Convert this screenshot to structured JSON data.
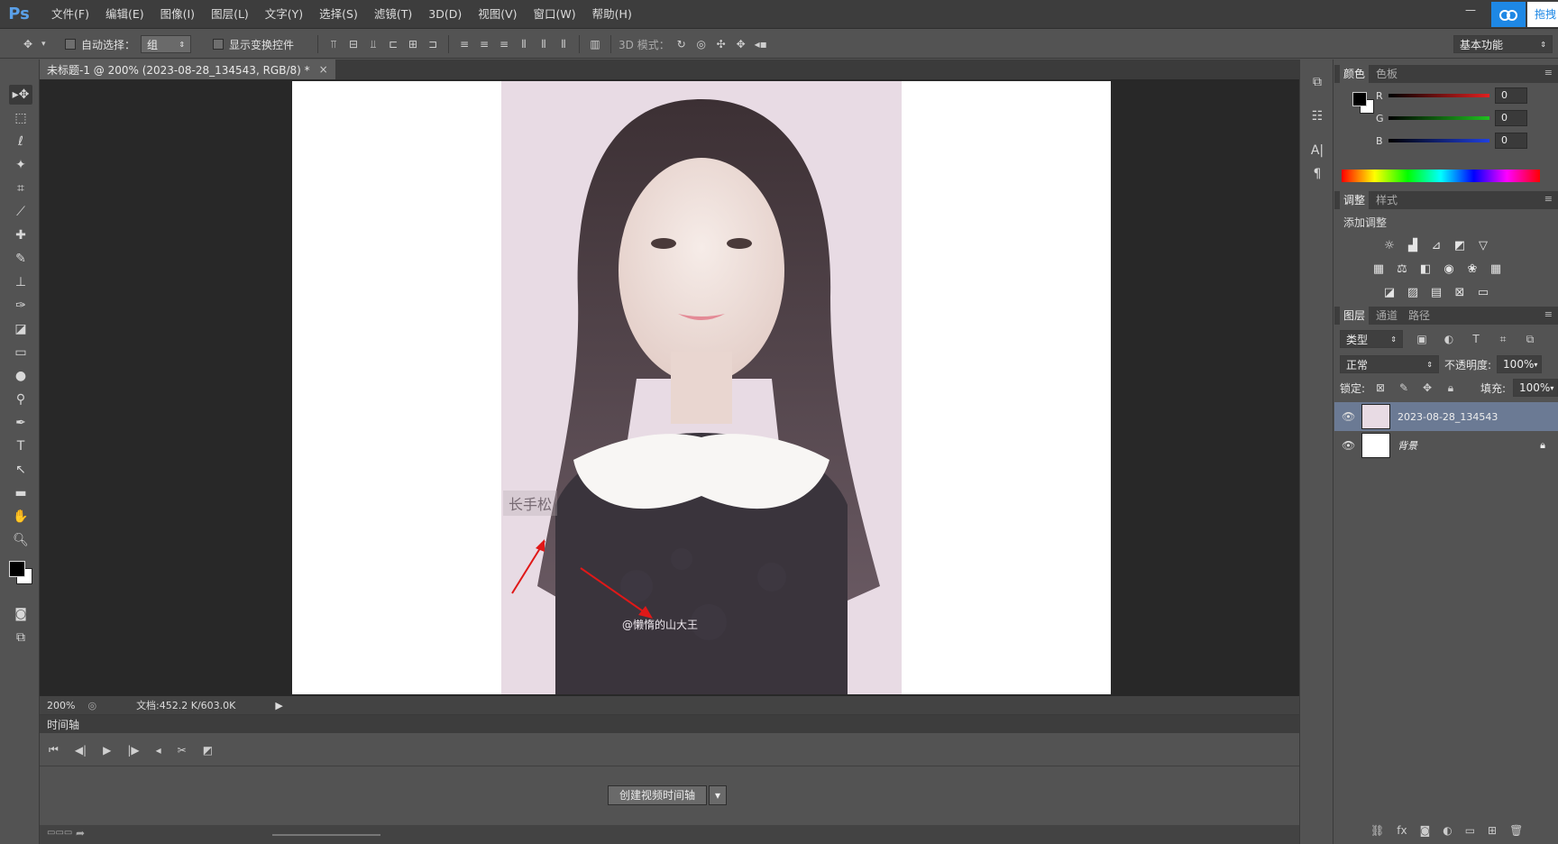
{
  "app": {
    "logo": "Ps"
  },
  "menu": [
    "文件(F)",
    "编辑(E)",
    "图像(I)",
    "图层(L)",
    "文字(Y)",
    "选择(S)",
    "滤镜(T)",
    "3D(D)",
    "视图(V)",
    "窗口(W)",
    "帮助(H)"
  ],
  "window": {
    "extra_label": "拖拽"
  },
  "options": {
    "auto_select_label": "自动选择：",
    "auto_select_value": "组",
    "show_transform_label": "显示变换控件",
    "mode_3d_label": "3D 模式：",
    "workspace_value": "基本功能"
  },
  "document": {
    "tab_title": "未标题-1 @ 200% (2023-08-28_134543, RGB/8) *",
    "photo_watermark_left": "长手松",
    "photo_watermark_bottom": "@懒惰的山大王"
  },
  "status": {
    "zoom": "200%",
    "doc_info": "文档:452.2 K/603.0K"
  },
  "timeline": {
    "title": "时间轴",
    "create_button": "创建视频时间轴"
  },
  "panels": {
    "color": {
      "tabs": [
        "颜色",
        "色板"
      ],
      "channels": [
        {
          "label": "R",
          "value": "0",
          "color": "#e02020"
        },
        {
          "label": "G",
          "value": "0",
          "color": "#20c020"
        },
        {
          "label": "B",
          "value": "0",
          "color": "#2040e0"
        }
      ]
    },
    "adjust": {
      "tabs": [
        "调整",
        "样式"
      ],
      "add_label": "添加调整"
    },
    "layers": {
      "tabs": [
        "图层",
        "通道",
        "路径"
      ],
      "filter_label": "类型",
      "blend_mode": "正常",
      "opacity_label": "不透明度:",
      "opacity_value": "100%",
      "lock_label": "锁定:",
      "fill_label": "填充:",
      "fill_value": "100%",
      "items": [
        {
          "name": "2023-08-28_134543",
          "selected": true
        },
        {
          "name": "背景",
          "selected": false
        }
      ]
    }
  },
  "colors": {
    "accent": "#1e88e5",
    "selected_layer": "#6b7a94",
    "arrow": "#e01818"
  }
}
